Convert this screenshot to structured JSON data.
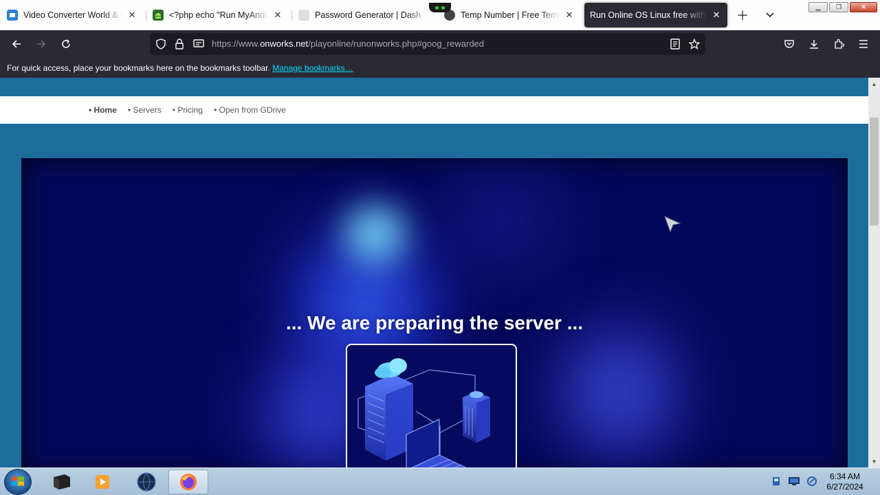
{
  "browser": {
    "tabs": [
      {
        "title": "Video Converter World & Cu",
        "favicon": "video-converter-icon",
        "active": false
      },
      {
        "title": "<?php echo \"Run MyAndroid",
        "favicon": "android-icon",
        "active": false
      },
      {
        "title": "Password Generator | Dash",
        "favicon": "password-icon",
        "active": false
      },
      {
        "title": "Temp Number | Free Tempor",
        "favicon": "globe-icon",
        "active": false
      },
      {
        "title": "Run Online OS Linux free with On",
        "favicon": "onworks-icon",
        "active": true
      }
    ],
    "url_prefix": "https://www.",
    "url_domain": "onworks.net",
    "url_path": "/playonline/runonworks.php#goog_rewarded",
    "bookmarks_text": "For quick access, place your bookmarks here on the bookmarks toolbar.",
    "bookmarks_link": "Manage bookmarks…"
  },
  "site": {
    "nav": [
      "• Home",
      "• Servers",
      "• Pricing",
      "• Open from GDrive"
    ],
    "heading": "... We are preparing the server ..."
  },
  "taskbar": {
    "time": "6:34 AM",
    "date": "6/27/2024"
  },
  "colors": {
    "page_bg": "#1c6d9c",
    "hero_bg": "#05085a",
    "browser_chrome": "#2b2a33",
    "link": "#00ddff"
  }
}
